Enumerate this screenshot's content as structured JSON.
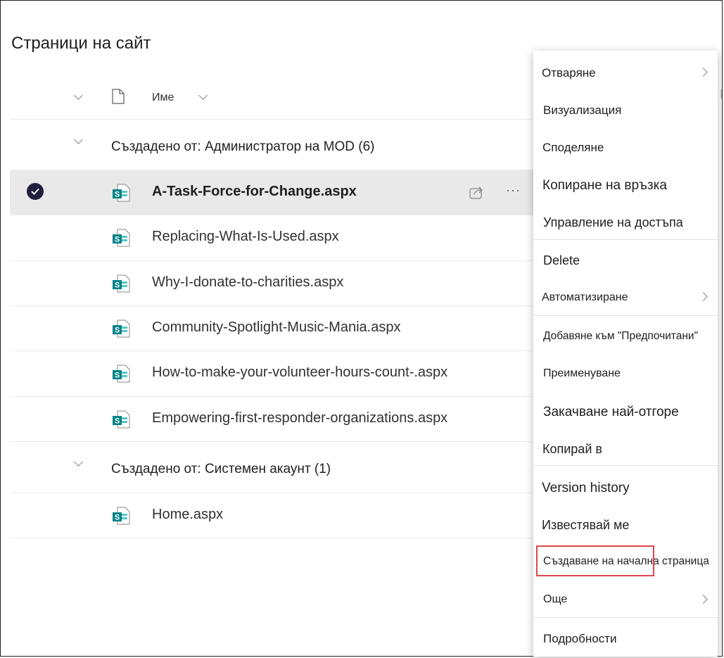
{
  "page": {
    "title": "Страници на сайт"
  },
  "columns": {
    "name": "Име"
  },
  "groups": [
    {
      "label": "Създадено от:  Администратор на MOD (6)",
      "rows": [
        {
          "name": "A-Task-Force-for-Change.aspx",
          "selected": true
        },
        {
          "name": "Replacing-What-Is-Used.aspx"
        },
        {
          "name": "Why-I-donate-to-charities.aspx"
        },
        {
          "name": "Community-Spotlight-Music-Mania.aspx"
        },
        {
          "name": "How-to-make-your-volunteer-hours-count-.aspx"
        },
        {
          "name": "Empowering-first-responder-organizations.aspx"
        }
      ]
    },
    {
      "label": "Създадено от: Системен акаунт (1)",
      "rows": [
        {
          "name": "Home.aspx"
        }
      ]
    }
  ],
  "menu": {
    "items": [
      {
        "label": "Отваряне",
        "submenu": true
      },
      {
        "label": "Визуализация"
      },
      {
        "label": "Споделяне"
      },
      {
        "label": "Копиране на връзка"
      },
      {
        "label": "Управление на достъпа"
      },
      {
        "label": "Delete"
      },
      {
        "label": "Автоматизиране",
        "submenu": true
      },
      {
        "label": "Добавяне към \"Предпочитани\""
      },
      {
        "label": "Преименуване"
      },
      {
        "label": "Закачване най-отгоре"
      },
      {
        "label": "Копирай в"
      },
      {
        "label": "Version history"
      },
      {
        "label": "Известявай ме"
      },
      {
        "label": "Създаване на начална страница",
        "highlighted": true
      },
      {
        "label": "Още",
        "submenu": true
      },
      {
        "label": "Подробности"
      }
    ]
  },
  "icons": {
    "select": "check-circle-icon",
    "group_toggle": "chevron-down-icon",
    "file_type": "document-icon",
    "page": "sharepoint-page-icon",
    "share": "share-icon",
    "more": "more-actions-icon",
    "submenu": "chevron-right-icon"
  },
  "colors": {
    "sharepoint": "#038387",
    "highlight": "#e0464b",
    "selected_row": "#e9e9e9"
  }
}
